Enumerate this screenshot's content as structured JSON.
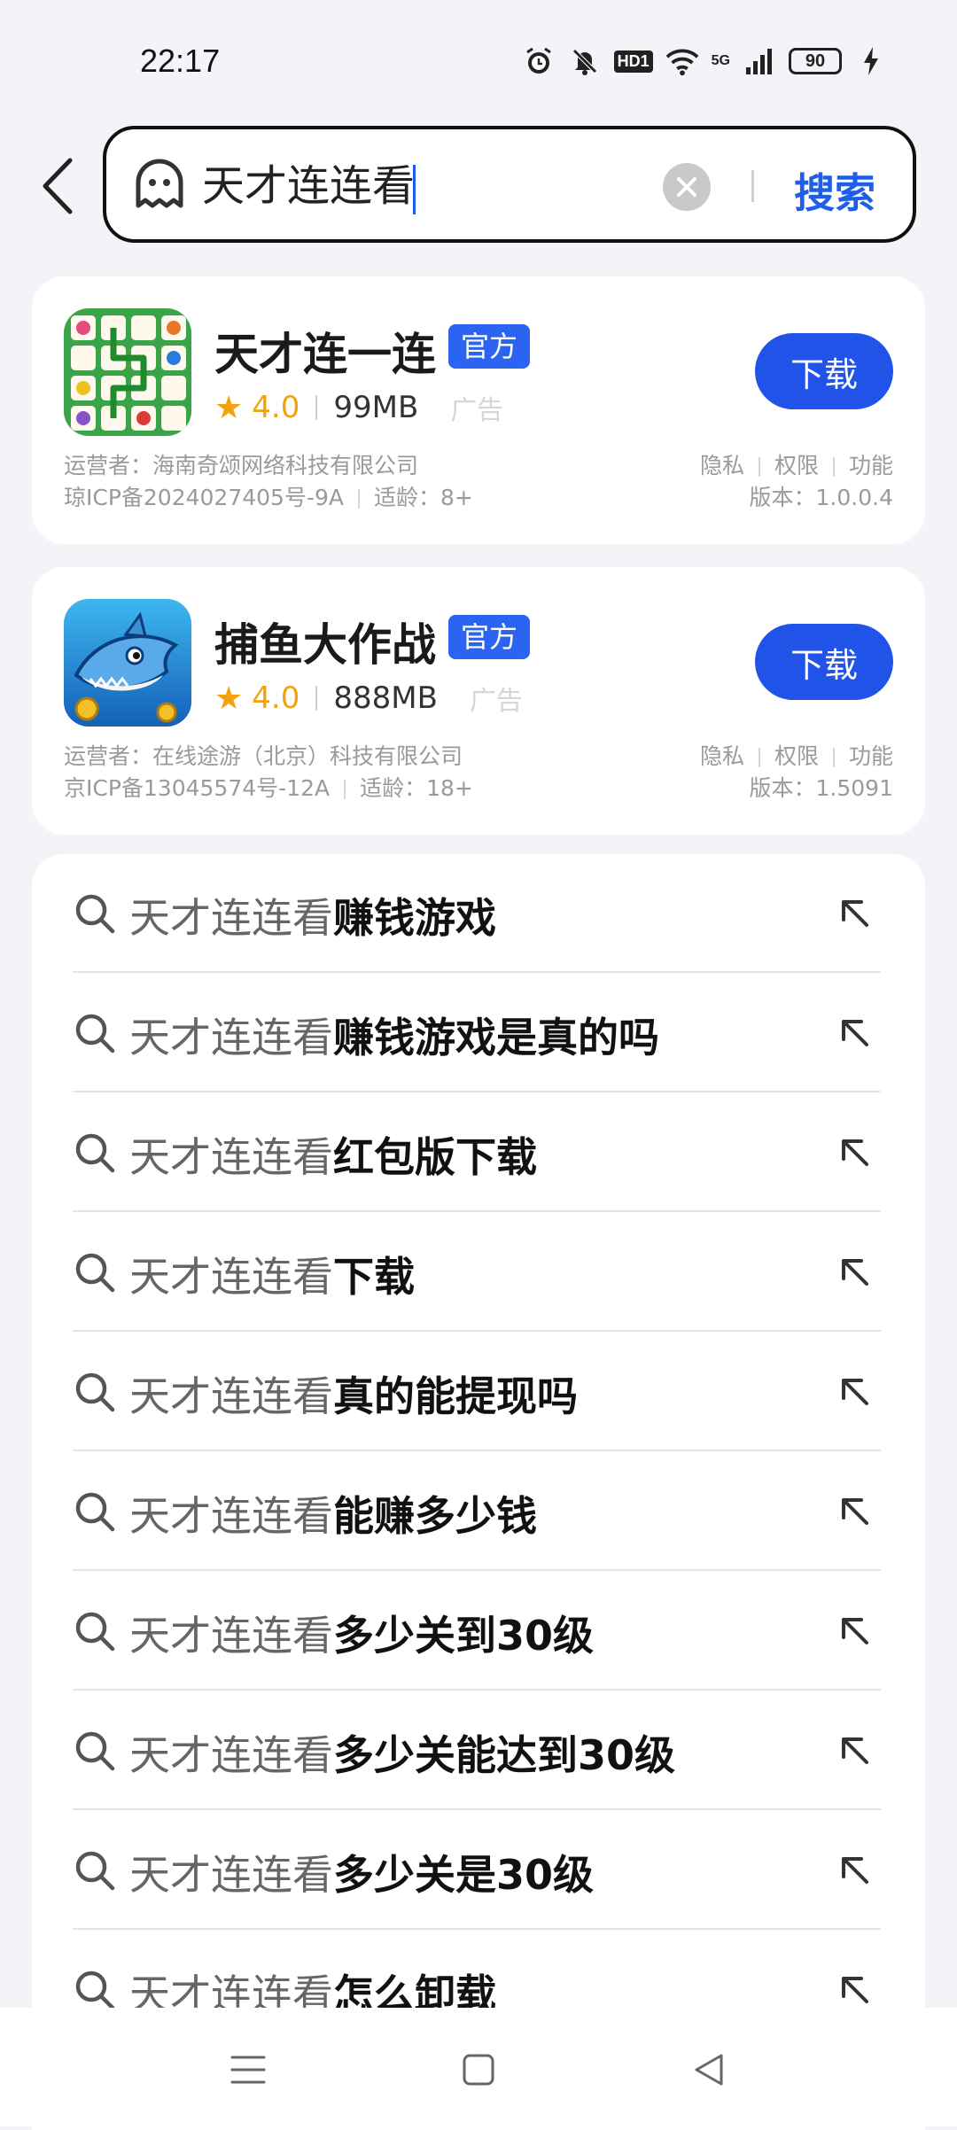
{
  "status_bar": {
    "time": "22:17",
    "battery": "90",
    "network": "5G",
    "hd": "HD1"
  },
  "search": {
    "query": "天才连连看",
    "submit_label": "搜索"
  },
  "apps": [
    {
      "name": "天才连一连",
      "badge": "官方",
      "rating": "4.0",
      "size": "99MB",
      "ad_label": "广告",
      "download_label": "下载",
      "operator": "运营者：海南奇颂网络科技有限公司",
      "icp": "琼ICP备2024027405号-9A",
      "age": "适龄：8+",
      "links": [
        "隐私",
        "权限",
        "功能"
      ],
      "version": "版本：1.0.0.4",
      "colors": {
        "icon_bg": "#3aa548"
      }
    },
    {
      "name": "捕鱼大作战",
      "badge": "官方",
      "rating": "4.0",
      "size": "888MB",
      "ad_label": "广告",
      "download_label": "下载",
      "operator": "运营者：在线途游（北京）科技有限公司",
      "icp": "京ICP备13045574号-12A",
      "age": "适龄：18+",
      "links": [
        "隐私",
        "权限",
        "功能"
      ],
      "version": "版本：1.5091",
      "colors": {
        "icon_bg": "#1f8fd8"
      }
    }
  ],
  "suggestions": [
    {
      "prefix": "天才连连看",
      "suffix": "赚钱游戏"
    },
    {
      "prefix": "天才连连看",
      "suffix": "赚钱游戏是真的吗"
    },
    {
      "prefix": "天才连连看",
      "suffix": "红包版下载"
    },
    {
      "prefix": "天才连连看",
      "suffix": "下载"
    },
    {
      "prefix": "天才连连看",
      "suffix": "真的能提现吗"
    },
    {
      "prefix": "天才连连看",
      "suffix": "能赚多少钱"
    },
    {
      "prefix": "天才连连看",
      "suffix": "多少关到30级"
    },
    {
      "prefix": "天才连连看",
      "suffix": "多少关能达到30级"
    },
    {
      "prefix": "天才连连看",
      "suffix": "多少关是30级"
    },
    {
      "prefix": "天才连连看",
      "suffix": "怎么卸载"
    }
  ],
  "colors": {
    "accent": "#2153e8",
    "rating": "#f2a20c",
    "background": "#f3f4f8"
  }
}
